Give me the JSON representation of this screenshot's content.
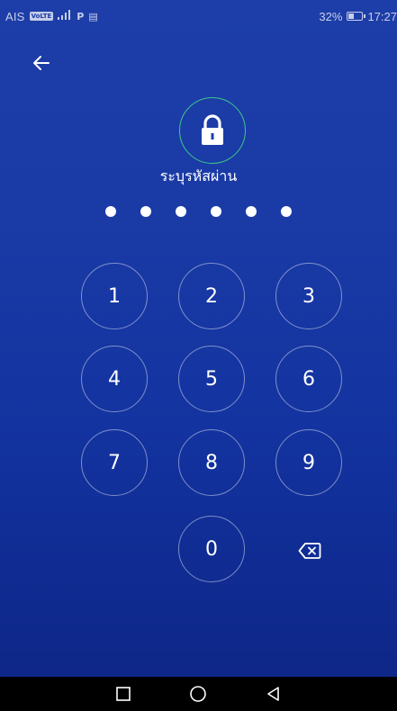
{
  "status_bar": {
    "carrier": "AIS",
    "network_badge": "VoLTE",
    "signal": "4G",
    "battery_percent": "32%",
    "time": "17:27"
  },
  "prompt": "ระบุรหัสผ่าน",
  "pin": {
    "entered": 6,
    "length": 6
  },
  "keypad": {
    "keys": [
      "1",
      "2",
      "3",
      "4",
      "5",
      "6",
      "7",
      "8",
      "9",
      "0"
    ]
  },
  "icons": {
    "back": "arrow-left-icon",
    "lock": "lock-icon",
    "backspace": "backspace-icon",
    "nav_recents": "square-icon",
    "nav_home": "circle-icon",
    "nav_back": "triangle-icon"
  },
  "colors": {
    "background_top": "#1d3ea8",
    "background_bottom": "#0d2585",
    "lock_ring": "#3cc78a",
    "nav_bar": "#000000"
  }
}
